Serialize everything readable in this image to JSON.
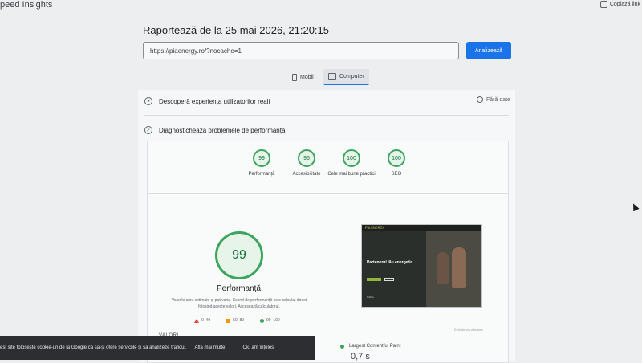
{
  "app": {
    "title": "peed Insights",
    "copy_link": "Copiază link"
  },
  "report": {
    "title": "Raportează de la 25 mai 2026, 21:20:15"
  },
  "search": {
    "url_value": "https://piaenergy.ro/?nocache=1",
    "analyze_label": "Analizează"
  },
  "device_tabs": [
    {
      "label": "Mobil",
      "icon": "phone-icon",
      "selected": false
    },
    {
      "label": "Computer",
      "icon": "monitor-icon",
      "selected": true
    }
  ],
  "sections": {
    "real_users": {
      "label": "Descoperă experiența utilizatorilor reali",
      "no_data": "Fără date"
    },
    "diagnose": {
      "label": "Diagnostichează problemele de performanță"
    }
  },
  "scores": [
    {
      "value": "99",
      "label": "Performanță"
    },
    {
      "value": "96",
      "label": "Accesibilitate"
    },
    {
      "value": "100",
      "label": "Cele mai bune practici"
    },
    {
      "value": "100",
      "label": "SEO"
    }
  ],
  "performance": {
    "score": "99",
    "label": "Performanță",
    "description": "Valorile sunt estimate și pot varia. Scorul de performanță este calculat direct folosind aceste valori. Accesează calculatorul.",
    "legend": [
      "0–49",
      "50–89",
      "90–100"
    ],
    "legend_colors": [
      "#e8453c",
      "#f29900",
      "#3ba55d"
    ]
  },
  "thumbnail": {
    "logo": "PIA ENERGY",
    "headline": "Partenerul tău energetic.",
    "stat": "1.000+"
  },
  "screenshot_caption": "Extinde vizualizarea",
  "metrics": {
    "values_label": "VALORI",
    "lcp_label": "Largest Contentful Paint",
    "lcp_value": "0,7 s"
  },
  "cookie": {
    "text": "est site folosește cookie-uri de la Google ca să-și ofere serviciile și să analizeze traficul.",
    "more": "Află mai multe",
    "ok": "Ok, am înțeles"
  }
}
